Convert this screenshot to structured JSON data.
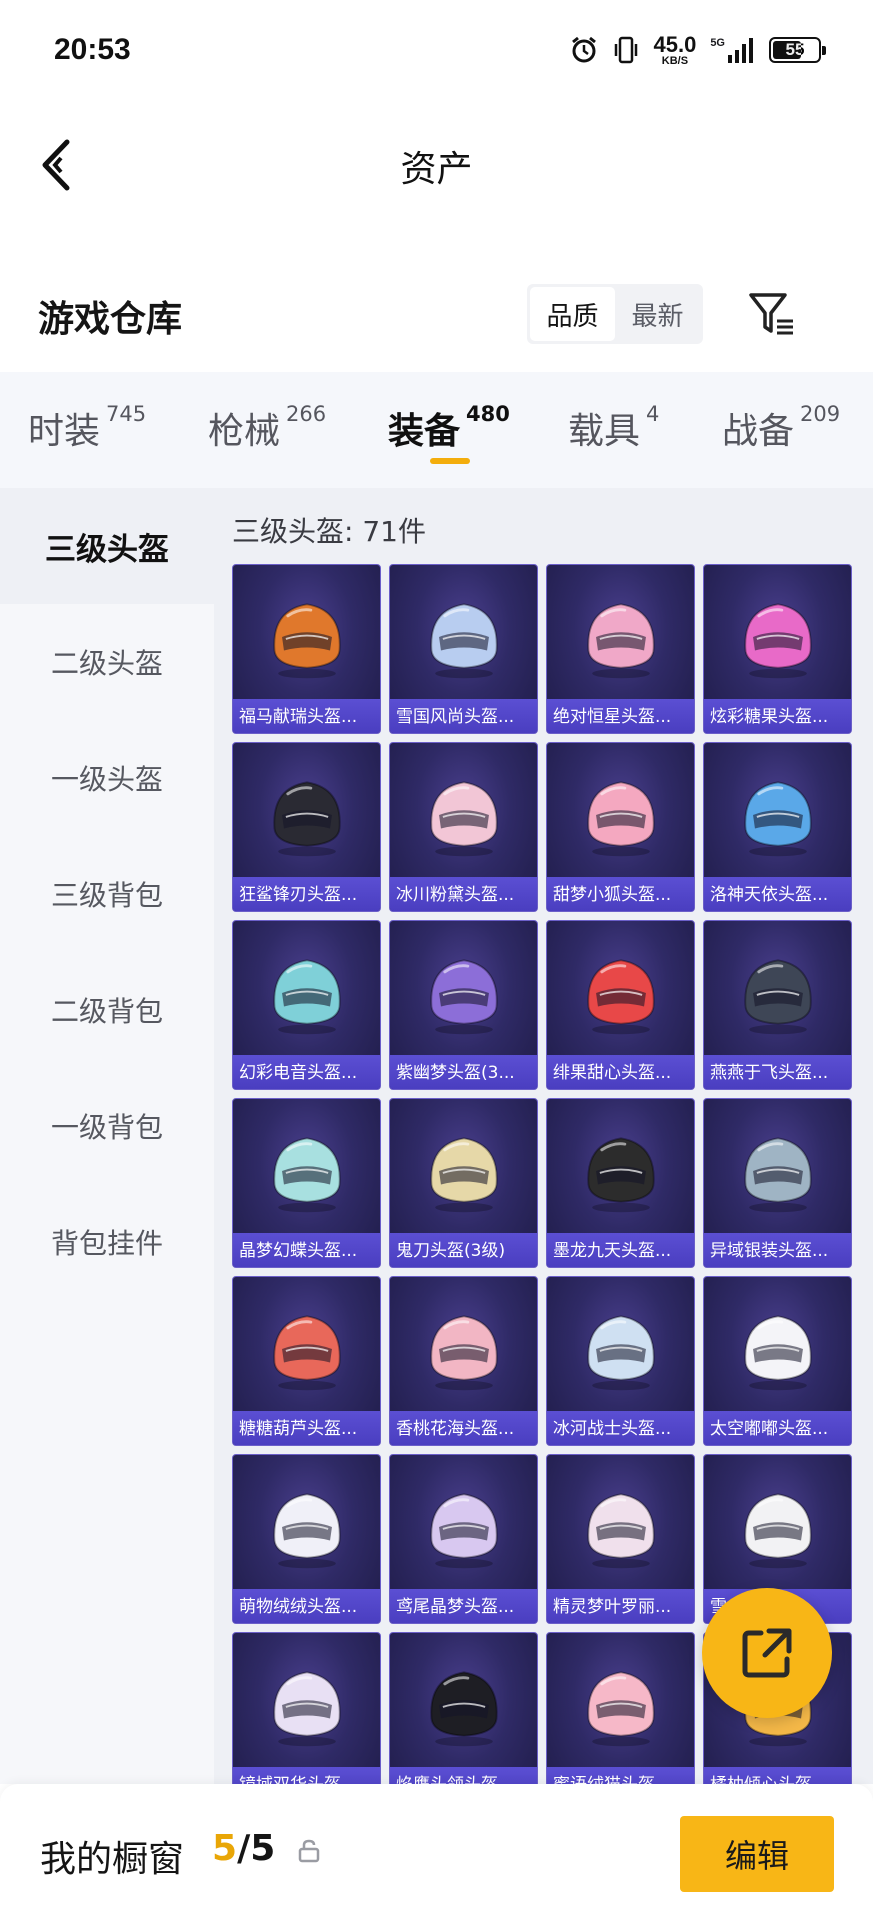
{
  "status_bar": {
    "time": "20:53",
    "net_speed_value": "45.0",
    "net_speed_unit": "KB/S",
    "network": "5G",
    "battery": "55",
    "icons": [
      "alarm-icon",
      "vibrate-icon",
      "signal-icon",
      "battery-icon"
    ]
  },
  "nav": {
    "title": "资产",
    "back_icon": "chevron-left-icon"
  },
  "warehouse": {
    "title": "游戏仓库",
    "sort_options": [
      {
        "label": "品质",
        "active": true
      },
      {
        "label": "最新",
        "active": false
      }
    ],
    "filter_icon": "filter-icon"
  },
  "category_tabs": [
    {
      "label": "时装",
      "count": "745",
      "active": false
    },
    {
      "label": "枪械",
      "count": "266",
      "active": false
    },
    {
      "label": "装备",
      "count": "480",
      "active": true
    },
    {
      "label": "载具",
      "count": "4",
      "active": false
    },
    {
      "label": "战备",
      "count": "209",
      "active": false
    }
  ],
  "sidebar": {
    "items": [
      {
        "label": "三级头盔",
        "active": true
      },
      {
        "label": "二级头盔",
        "active": false
      },
      {
        "label": "一级头盔",
        "active": false
      },
      {
        "label": "三级背包",
        "active": false
      },
      {
        "label": "二级背包",
        "active": false
      },
      {
        "label": "一级背包",
        "active": false
      },
      {
        "label": "背包挂件",
        "active": false
      }
    ]
  },
  "grid": {
    "title": "三级头盔: 71件",
    "items": [
      {
        "name": "福马献瑞头盔...",
        "color": "#e0782c"
      },
      {
        "name": "雪国风尚头盔...",
        "color": "#b8cdf0"
      },
      {
        "name": "绝对恒星头盔...",
        "color": "#f0a8c8"
      },
      {
        "name": "炫彩糖果头盔...",
        "color": "#e86ac8"
      },
      {
        "name": "狂鲨锋刃头盔...",
        "color": "#2a2a33"
      },
      {
        "name": "冰川粉黛头盔...",
        "color": "#f2c6d6"
      },
      {
        "name": "甜梦小狐头盔...",
        "color": "#f4a8c0"
      },
      {
        "name": "洛神天依头盔...",
        "color": "#5aa8e8"
      },
      {
        "name": "幻彩电音头盔...",
        "color": "#7fd0d8"
      },
      {
        "name": "紫幽梦头盔(3...",
        "color": "#8c6ed8"
      },
      {
        "name": "绯果甜心头盔...",
        "color": "#e84848"
      },
      {
        "name": "燕燕于飞头盔...",
        "color": "#3e4656"
      },
      {
        "name": "晶梦幻蝶头盔...",
        "color": "#a8e0e0"
      },
      {
        "name": "鬼刀头盔(3级)",
        "color": "#e6d8a8"
      },
      {
        "name": "墨龙九天头盔...",
        "color": "#2c2c2c"
      },
      {
        "name": "异域银装头盔...",
        "color": "#9fb4c4"
      },
      {
        "name": "糖糖葫芦头盔...",
        "color": "#e8685a"
      },
      {
        "name": "香桃花海头盔...",
        "color": "#f2b6c4"
      },
      {
        "name": "冰河战士头盔...",
        "color": "#cfe0f2"
      },
      {
        "name": "太空嘟嘟头盔...",
        "color": "#f4f4f8"
      },
      {
        "name": "萌物绒绒头盔...",
        "color": "#f0f0f8"
      },
      {
        "name": "鸢尾晶梦头盔...",
        "color": "#d8c8f0"
      },
      {
        "name": "精灵梦叶罗丽...",
        "color": "#f0e0ec"
      },
      {
        "name": "雪...",
        "color": "#f2f2f4"
      },
      {
        "name": "镜域双华头盔...",
        "color": "#e8e0f4"
      },
      {
        "name": "焰鹰头领头盔...",
        "color": "#1e1e24"
      },
      {
        "name": "蜜语绒猫头盔...",
        "color": "#f6b8c8"
      },
      {
        "name": "橘柚倾心头盔...",
        "color": "#f4b848"
      }
    ]
  },
  "share_button": {
    "icon": "share-icon"
  },
  "bottom_bar": {
    "label": "我的橱窗",
    "current": "5",
    "separator": "/",
    "max": "5",
    "lock_icon": "lock-icon",
    "edit_label": "编辑"
  }
}
